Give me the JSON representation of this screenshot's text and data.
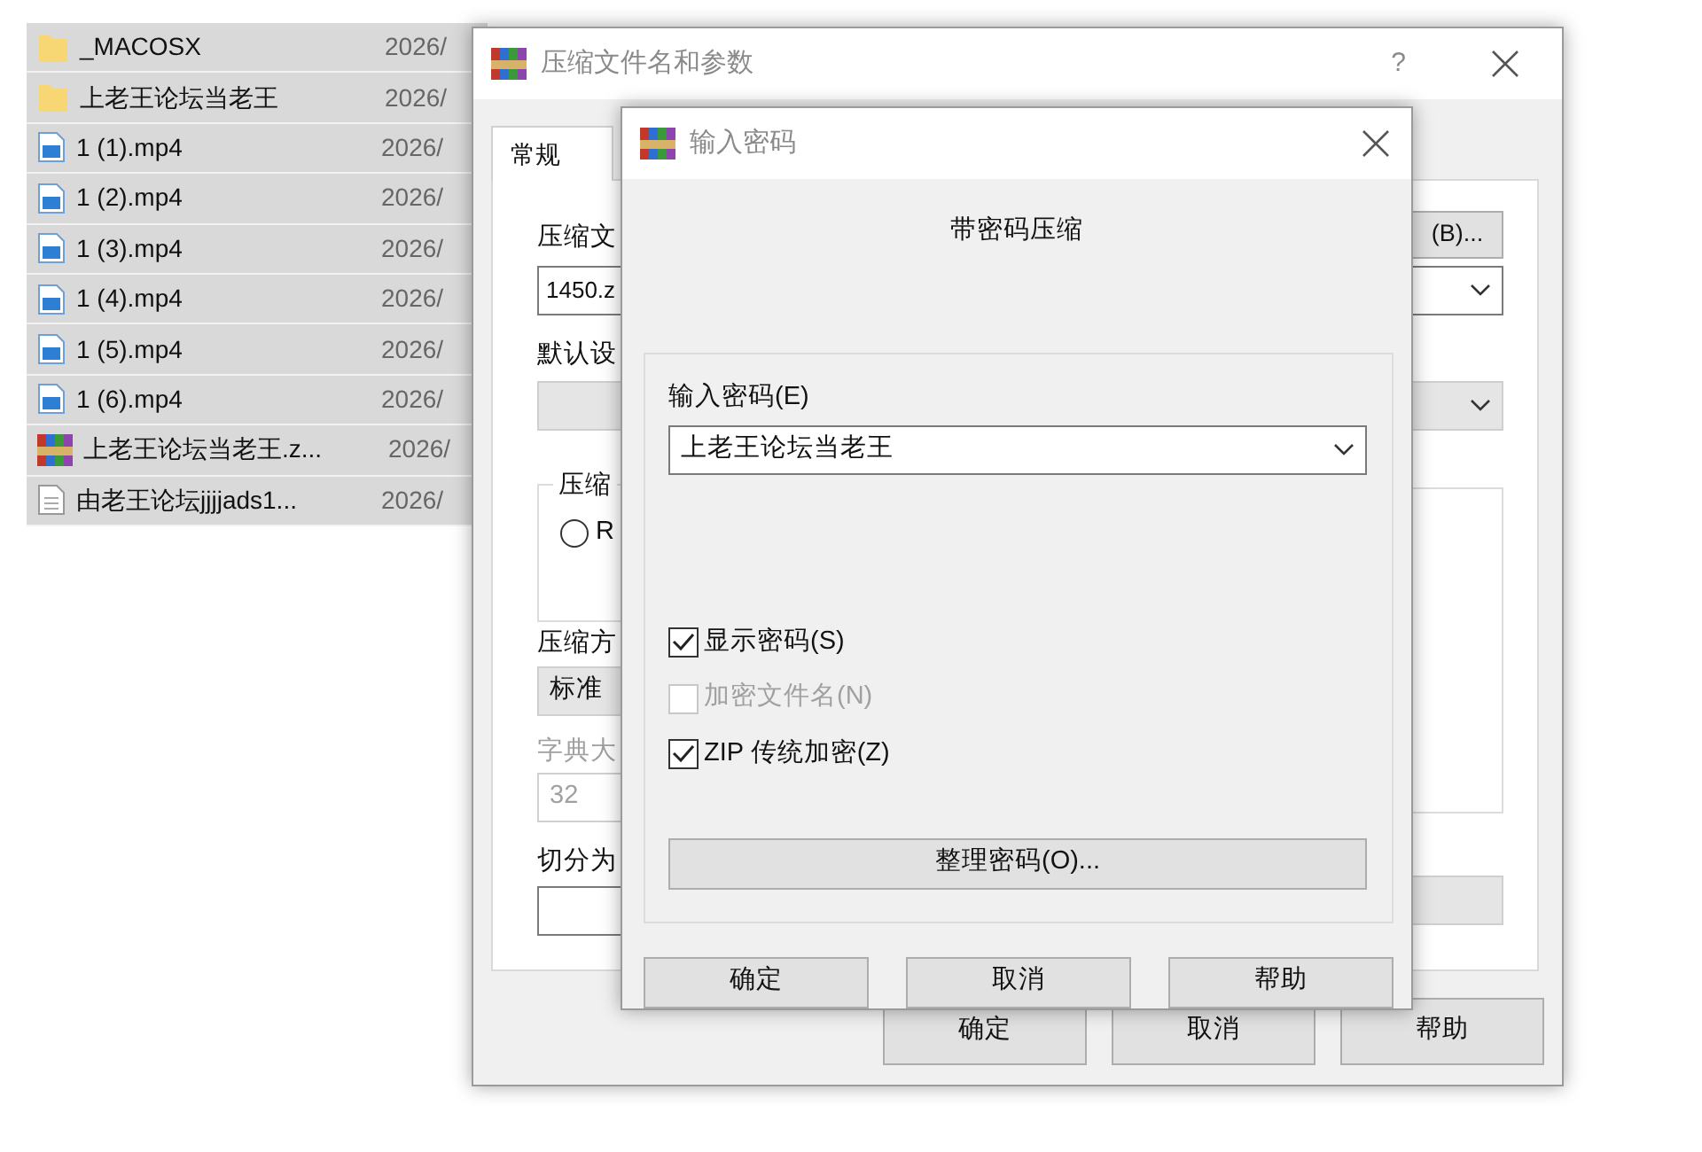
{
  "file_list": {
    "rows": [
      {
        "kind": "folder",
        "name": "_MACOSX",
        "date": "2026/",
        "selected": true
      },
      {
        "kind": "folder",
        "name": "上老王论坛当老王",
        "date": "2026/",
        "selected": true
      },
      {
        "kind": "video",
        "name": "1 (1).mp4",
        "date": "2026/",
        "selected": true
      },
      {
        "kind": "video",
        "name": "1 (2).mp4",
        "date": "2026/",
        "selected": true
      },
      {
        "kind": "video",
        "name": "1 (3).mp4",
        "date": "2026/",
        "selected": true
      },
      {
        "kind": "video",
        "name": "1 (4).mp4",
        "date": "2026/",
        "selected": true
      },
      {
        "kind": "video",
        "name": "1 (5).mp4",
        "date": "2026/",
        "selected": true
      },
      {
        "kind": "video",
        "name": "1 (6).mp4",
        "date": "2026/",
        "selected": true
      },
      {
        "kind": "archive",
        "name": "上老王论坛当老王.z...",
        "date": "2026/",
        "selected": true
      },
      {
        "kind": "text",
        "name": "由老王论坛jjjjads1...",
        "date": "2026/",
        "selected": true
      }
    ]
  },
  "archive_dialog": {
    "title": "压缩文件名和参数",
    "help": "?",
    "tabs": [
      {
        "label": "常规",
        "selected": true
      }
    ],
    "archive_name_label": "压缩文",
    "archive_name_value": "1450.z",
    "browse_button": "(B)...",
    "profile_label": "默认设",
    "format_group": {
      "label": "压缩",
      "options": [
        {
          "label": "R",
          "selected": false
        }
      ]
    },
    "method_label": "压缩方",
    "method_value": "标准",
    "dictionary_label": "字典大",
    "dictionary_value": "32",
    "dictionary_disabled": true,
    "split_label": "切分为",
    "buttons": [
      "确定",
      "取消",
      "帮助"
    ]
  },
  "password_dialog": {
    "title": "输入密码",
    "heading": "带密码压缩",
    "password_label": "输入密码(E)",
    "password_value": "上老王论坛当老王",
    "options": [
      {
        "label": "显示密码(S)",
        "checked": true,
        "disabled": false
      },
      {
        "label": "加密文件名(N)",
        "checked": false,
        "disabled": true
      },
      {
        "label": "ZIP 传统加密(Z)",
        "checked": true,
        "disabled": false
      }
    ],
    "manage_button": "整理密码(O)...",
    "buttons": [
      "确定",
      "取消",
      "帮助"
    ]
  }
}
